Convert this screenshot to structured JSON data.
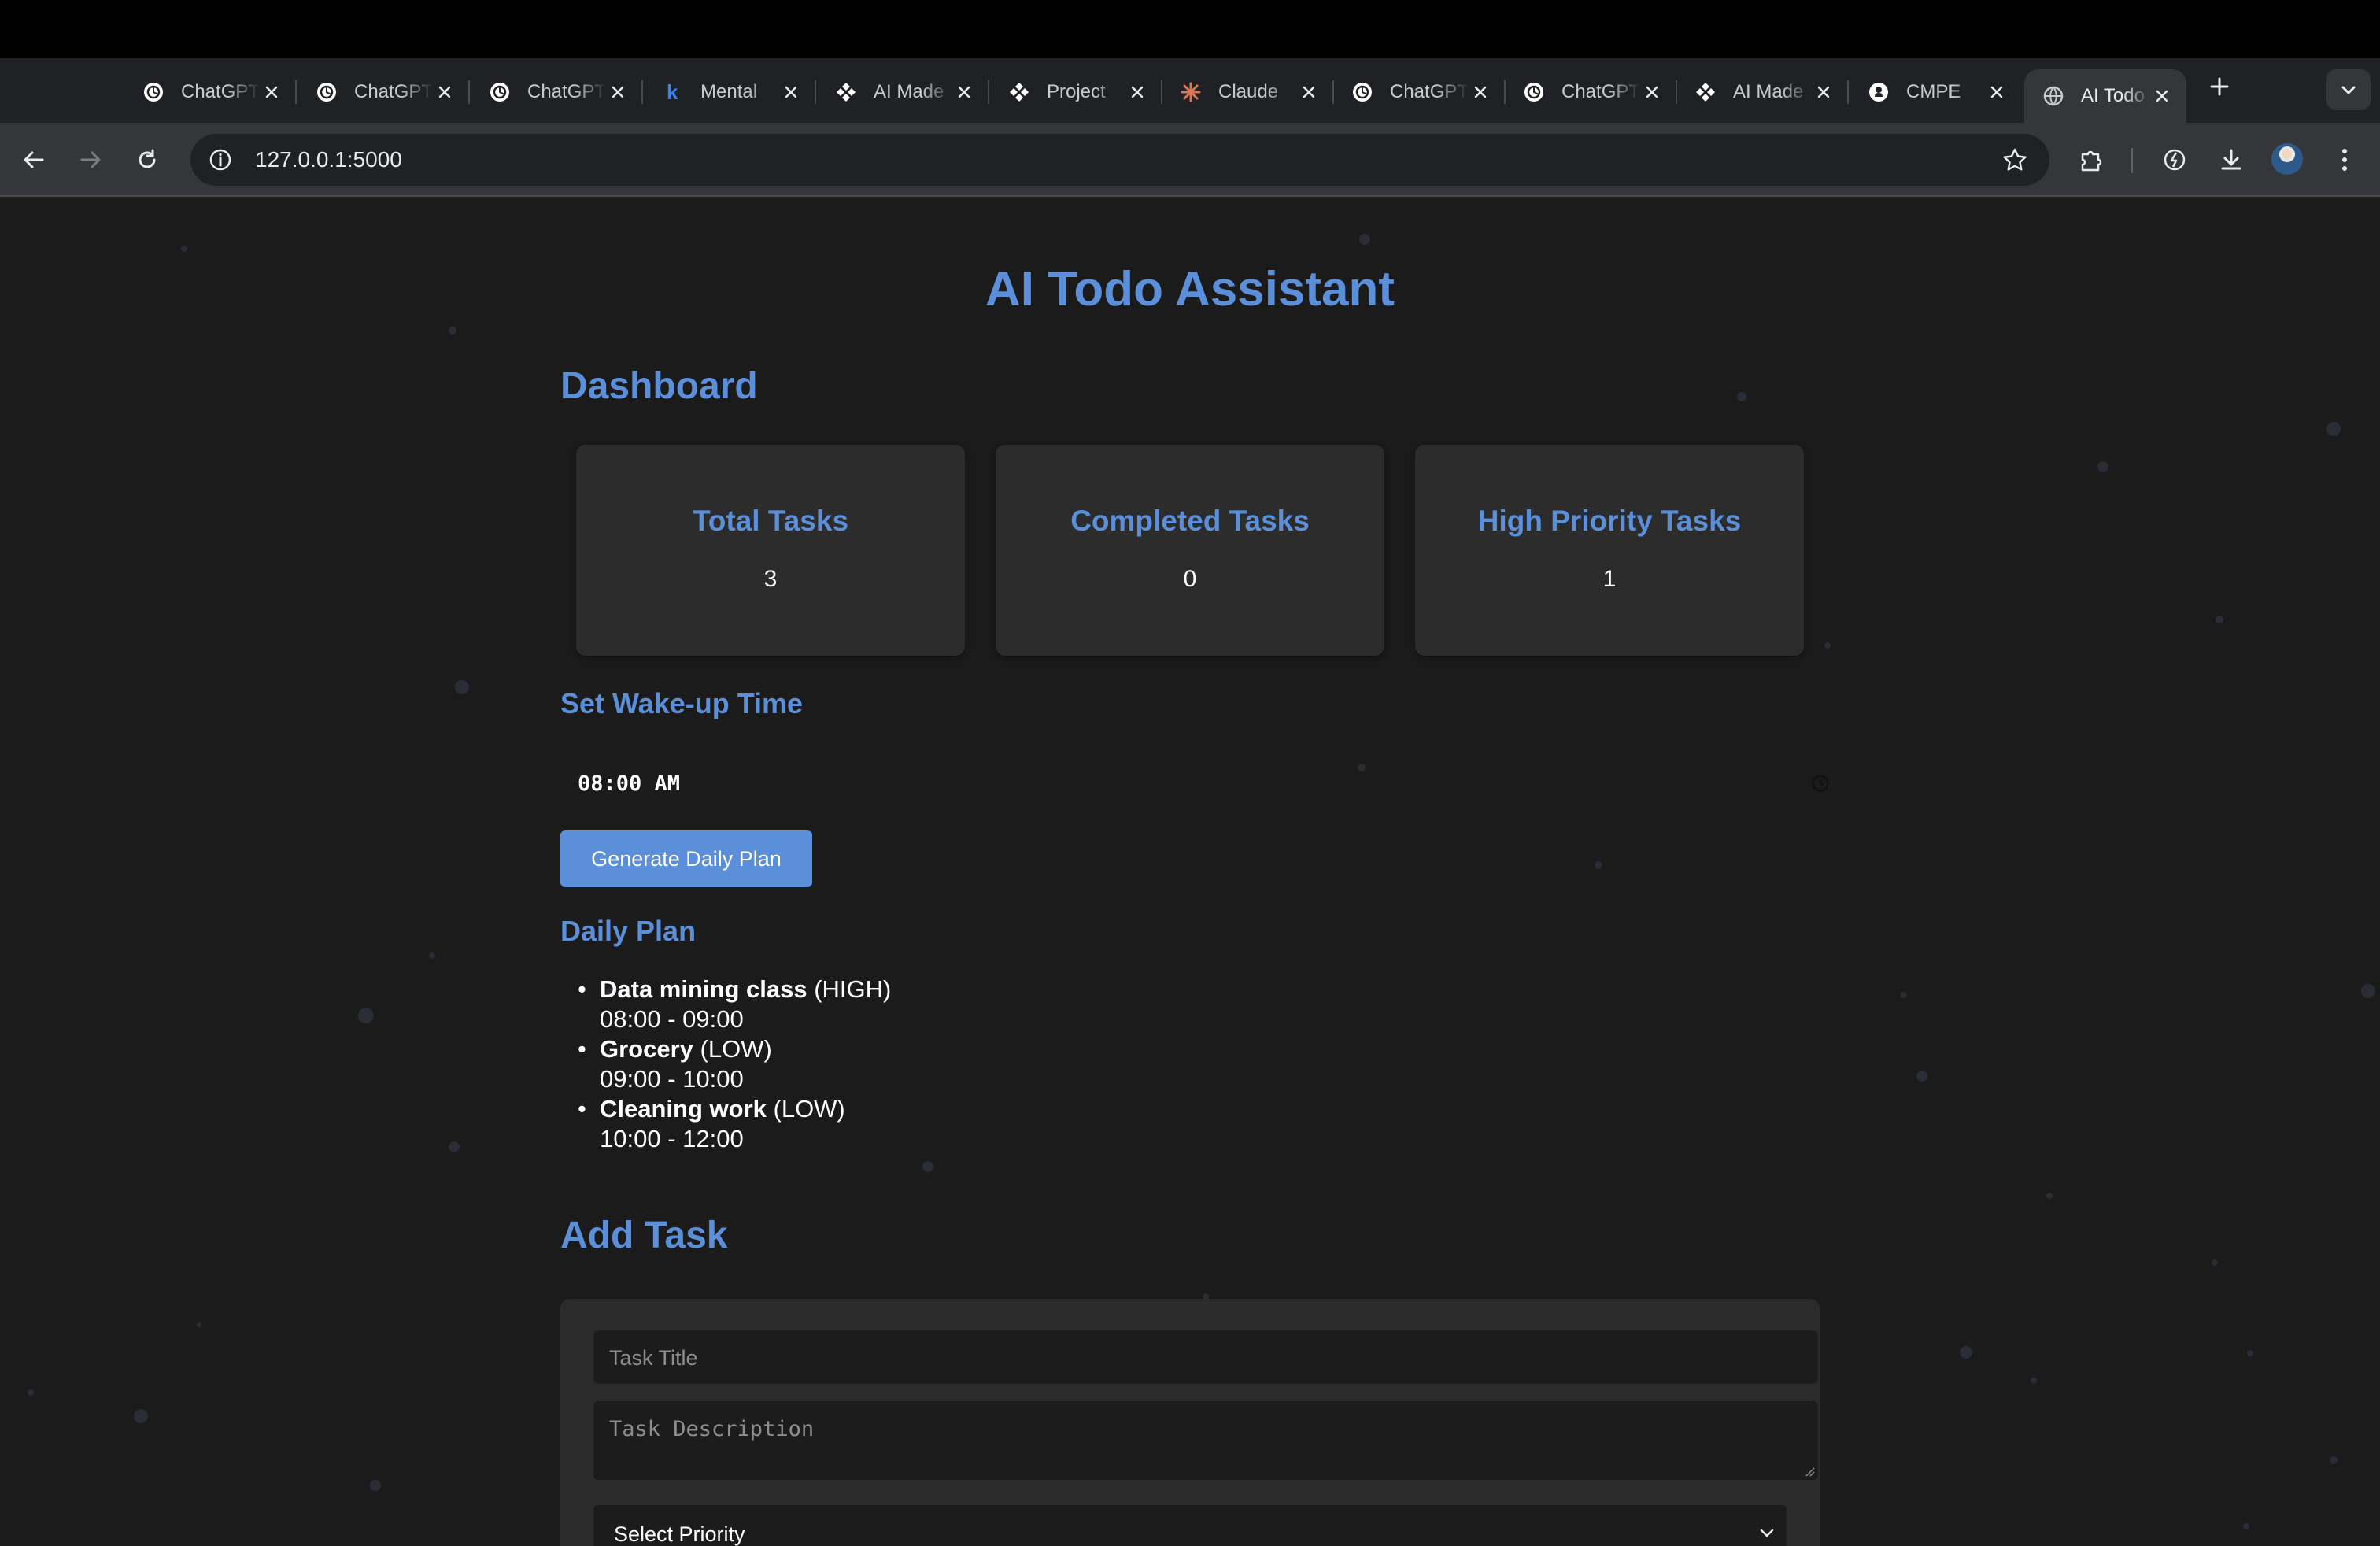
{
  "browser": {
    "tabs": [
      {
        "title": "ChatGPT",
        "icon": "openai-icon",
        "active": false
      },
      {
        "title": "ChatGPT",
        "icon": "openai-icon",
        "active": false
      },
      {
        "title": "ChatGPT",
        "icon": "openai-icon",
        "active": false
      },
      {
        "title": "Mental",
        "icon": "k-icon",
        "active": false
      },
      {
        "title": "AI Made",
        "icon": "diamond-icon",
        "active": false
      },
      {
        "title": "Project",
        "icon": "diamond-icon",
        "active": false
      },
      {
        "title": "Claude",
        "icon": "claude-icon",
        "active": false
      },
      {
        "title": "ChatGPT",
        "icon": "openai-icon",
        "active": false
      },
      {
        "title": "ChatGPT",
        "icon": "openai-icon",
        "active": false
      },
      {
        "title": "AI Made",
        "icon": "diamond-icon",
        "active": false
      },
      {
        "title": "CMPE",
        "icon": "github-icon",
        "active": false
      },
      {
        "title": "AI Todo",
        "icon": "globe-icon",
        "active": true
      }
    ],
    "url": "127.0.0.1:5000"
  },
  "app": {
    "title": "AI Todo Assistant"
  },
  "dashboard": {
    "heading": "Dashboard",
    "cards": [
      {
        "label": "Total Tasks",
        "value": "3"
      },
      {
        "label": "Completed Tasks",
        "value": "0"
      },
      {
        "label": "High Priority Tasks",
        "value": "1"
      }
    ]
  },
  "wake": {
    "heading": "Set Wake-up Time",
    "time": "08:00 AM"
  },
  "generate_button": "Generate Daily Plan",
  "daily_plan": {
    "heading": "Daily Plan",
    "items": [
      {
        "name": "Data mining class",
        "priority": "(HIGH)",
        "time": "08:00 - 09:00"
      },
      {
        "name": "Grocery",
        "priority": "(LOW)",
        "time": "09:00 - 10:00"
      },
      {
        "name": "Cleaning work",
        "priority": "(LOW)",
        "time": "10:00 - 12:00"
      }
    ]
  },
  "add_task": {
    "heading": "Add Task",
    "title_placeholder": "Task Title",
    "description_placeholder": "Task Description",
    "priority_value": "Select Priority"
  },
  "colors": {
    "accent": "#5b8fd9",
    "background": "#1b1b1c",
    "card": "#2c2c2d"
  }
}
